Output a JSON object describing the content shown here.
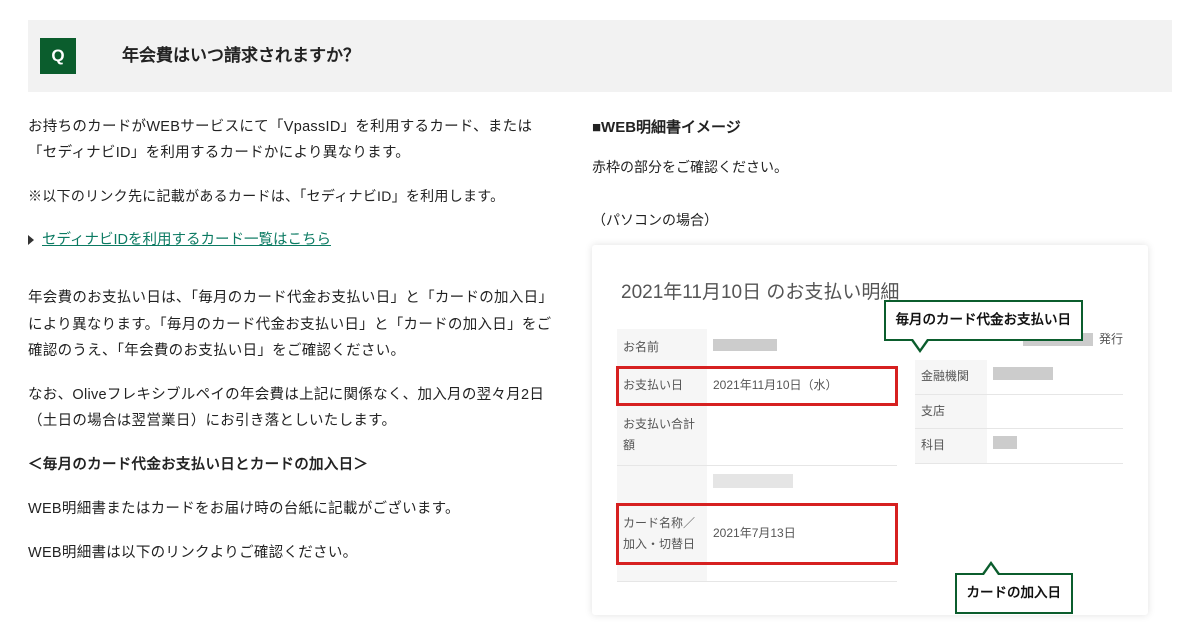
{
  "q": {
    "badge": "Q",
    "title": "年会費はいつ請求されますか？"
  },
  "left": {
    "p1": "お持ちのカードがWEBサービスにて「VpassID」を利用するカード、または「セディナビID」を利用するカードかにより異なります。",
    "note": "※以下のリンク先に記載があるカードは、「セディナビID」を利用します。",
    "link": "セディナビIDを利用するカード一覧はこちら",
    "p2": "年会費のお支払い日は、「毎月のカード代金お支払い日」と「カードの加入日」により異なります。「毎月のカード代金お支払い日」と「カードの加入日」をご確認のうえ、「年会費のお支払い日」をご確認ください。",
    "p3": "なお、Oliveフレキシブルペイの年会費は上記に関係なく、加入月の翌々月2日（土日の場合は翌営業日）にお引き落としいたします。",
    "h": "＜毎月のカード代金お支払い日とカードの加入日＞",
    "p4": "WEB明細書またはカードをお届け時の台紙に記載がございます。",
    "p5": "WEB明細書は以下のリンクよりご確認ください。"
  },
  "right": {
    "h": "■WEB明細書イメージ",
    "sub": "赤枠の部分をご確認ください。",
    "pc": "（パソコンの場合）"
  },
  "stmt": {
    "title": "2021年11月10日 のお支払い明細",
    "issue": "発行",
    "rows": {
      "name": "お名前",
      "payDate": "お支払い日",
      "payDateV": "2021年11月10日（水）",
      "total": "お支払い合計額",
      "cardName": "カード名称／\n加入・切替日",
      "joinV": "2021年7月13日"
    },
    "side": {
      "bank": "金融機関",
      "branch": "支店",
      "item": "科目"
    },
    "callout": {
      "top": "毎月のカード代金お支払い日",
      "bottom": "カードの加入日"
    }
  }
}
